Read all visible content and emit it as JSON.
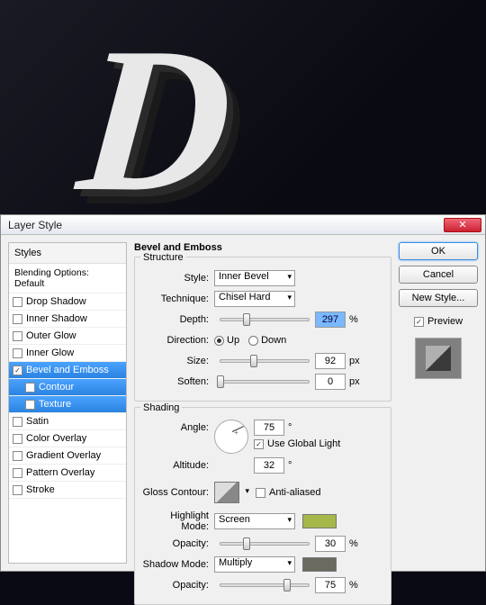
{
  "window": {
    "title": "Layer Style"
  },
  "buttons": {
    "ok": "OK",
    "cancel": "Cancel",
    "newstyle": "New Style...",
    "preview": "Preview"
  },
  "styles_header": "Styles",
  "blending_options": "Blending Options: Default",
  "style_list": [
    {
      "label": "Drop Shadow",
      "checked": false
    },
    {
      "label": "Inner Shadow",
      "checked": false
    },
    {
      "label": "Outer Glow",
      "checked": false
    },
    {
      "label": "Inner Glow",
      "checked": false
    },
    {
      "label": "Bevel and Emboss",
      "checked": true,
      "selected": true
    },
    {
      "label": "Contour",
      "checked": false,
      "sub": true,
      "selected": true
    },
    {
      "label": "Texture",
      "checked": false,
      "sub": true,
      "selected": true
    },
    {
      "label": "Satin",
      "checked": false
    },
    {
      "label": "Color Overlay",
      "checked": false
    },
    {
      "label": "Gradient Overlay",
      "checked": false
    },
    {
      "label": "Pattern Overlay",
      "checked": false
    },
    {
      "label": "Stroke",
      "checked": false
    }
  ],
  "panel_title": "Bevel and Emboss",
  "structure": {
    "legend": "Structure",
    "style_label": "Style:",
    "style_value": "Inner Bevel",
    "technique_label": "Technique:",
    "technique_value": "Chisel Hard",
    "depth_label": "Depth:",
    "depth_value": "297",
    "depth_unit": "%",
    "direction_label": "Direction:",
    "up": "Up",
    "down": "Down",
    "size_label": "Size:",
    "size_value": "92",
    "size_unit": "px",
    "soften_label": "Soften:",
    "soften_value": "0",
    "soften_unit": "px"
  },
  "shading": {
    "legend": "Shading",
    "angle_label": "Angle:",
    "angle_value": "75",
    "angle_unit": "°",
    "global_light": "Use Global Light",
    "altitude_label": "Altitude:",
    "altitude_value": "32",
    "altitude_unit": "°",
    "gloss_label": "Gloss Contour:",
    "antialiased": "Anti-aliased",
    "highlight_mode_label": "Highlight Mode:",
    "highlight_mode_value": "Screen",
    "highlight_color": "#a6b84a",
    "highlight_opacity_label": "Opacity:",
    "highlight_opacity_value": "30",
    "highlight_opacity_unit": "%",
    "shadow_mode_label": "Shadow Mode:",
    "shadow_mode_value": "Multiply",
    "shadow_color": "#6a6a60",
    "shadow_opacity_label": "Opacity:",
    "shadow_opacity_value": "75",
    "shadow_opacity_unit": "%"
  }
}
